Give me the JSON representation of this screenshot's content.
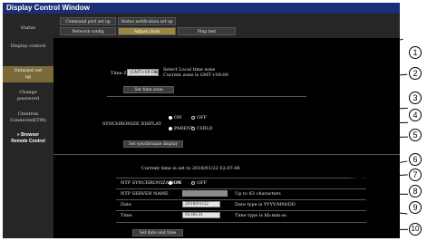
{
  "window": {
    "title": "Display Control Window"
  },
  "sidebar": {
    "items": [
      {
        "label": "Status"
      },
      {
        "label": "Display control"
      },
      {
        "label": "Detailed set up"
      },
      {
        "label": "Change password"
      },
      {
        "label": "Crestron Connected(TM)"
      },
      {
        "label": "» Browser Remote Control"
      }
    ]
  },
  "tabs": {
    "row1": [
      "Command port set up",
      "Status notification set up"
    ],
    "row2": [
      "Network config",
      "Adjust clock",
      "Ping test"
    ]
  },
  "timezone": {
    "label": "Time Zone",
    "value": "(GMT+09:00)",
    "info_line1": "Select Local time zone",
    "info_line2": "Current zone is GMT+09:00",
    "button": "Set time zone"
  },
  "sync": {
    "label": "SYNCHRONIZE DISPLAY",
    "on": "ON",
    "off": "OFF",
    "parent": "PARENT",
    "child": "CHILD",
    "button": "Set synchronize display"
  },
  "clock": {
    "current_time": "Current time is set to 2018/01/22 02:07:06",
    "ntp_sync_label": "NTP SYNCHRONIZATION",
    "on": "ON",
    "off": "OFF",
    "ntp_server_label": "NTP SERVER NAME",
    "ntp_server_value": "",
    "ntp_server_hint": "Up to 63 characters",
    "date_label": "Date",
    "date_value": "2018/01/22",
    "date_hint": "Date type is YYYY/MM/DD",
    "time_label": "Time",
    "time_value": "02:06:31",
    "time_hint": "Time type is hh:mm:ss",
    "button": "Set date and time"
  },
  "callouts": [
    "1",
    "2",
    "3",
    "4",
    "5",
    "6",
    "7",
    "8",
    "9",
    "10"
  ]
}
